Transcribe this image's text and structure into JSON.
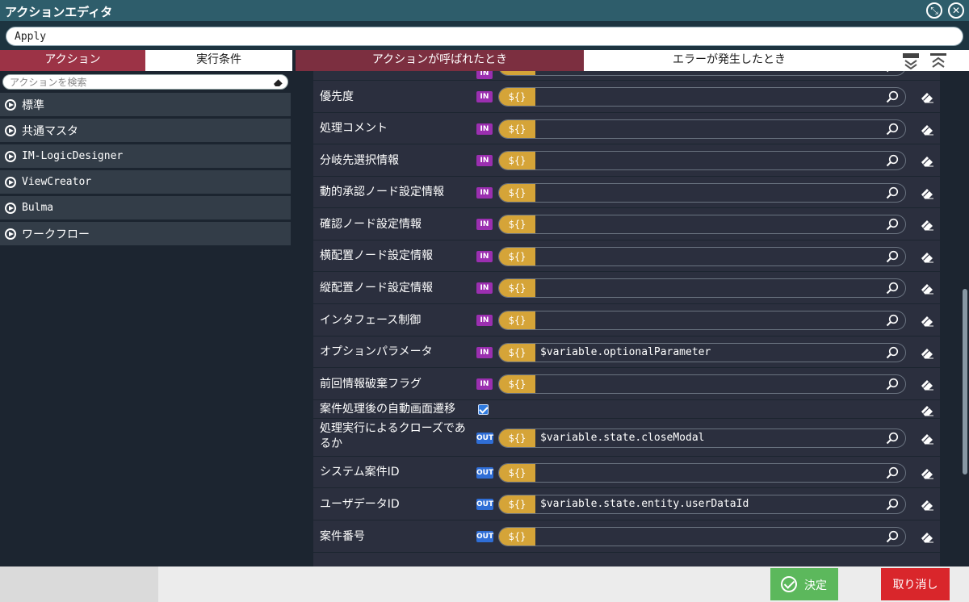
{
  "window": {
    "title": "アクションエディタ"
  },
  "action_name": "Apply",
  "left_tabs": [
    {
      "label": "アクション",
      "active": true
    },
    {
      "label": "実行条件",
      "active": false
    }
  ],
  "action_search": {
    "placeholder": "アクションを検索",
    "value": ""
  },
  "categories": [
    {
      "label": "標準"
    },
    {
      "label": "共通マスタ"
    },
    {
      "label": "IM-LogicDesigner"
    },
    {
      "label": "ViewCreator"
    },
    {
      "label": "Bulma"
    },
    {
      "label": "ワークフロー"
    }
  ],
  "right_tabs": [
    {
      "label": "アクションが呼ばれたとき",
      "active": true
    },
    {
      "label": "エラーが発生したとき",
      "active": false
    }
  ],
  "template_token": "${}",
  "params": [
    {
      "label": "優先度",
      "dir": "IN",
      "value": ""
    },
    {
      "label": "処理コメント",
      "dir": "IN",
      "value": ""
    },
    {
      "label": "分岐先選択情報",
      "dir": "IN",
      "value": ""
    },
    {
      "label": "動的承認ノード設定情報",
      "dir": "IN",
      "value": ""
    },
    {
      "label": "確認ノード設定情報",
      "dir": "IN",
      "value": ""
    },
    {
      "label": "横配置ノード設定情報",
      "dir": "IN",
      "value": ""
    },
    {
      "label": "縦配置ノード設定情報",
      "dir": "IN",
      "value": ""
    },
    {
      "label": "インタフェース制御",
      "dir": "IN",
      "value": ""
    },
    {
      "label": "オプションパラメータ",
      "dir": "IN",
      "value": "$variable.optionalParameter"
    },
    {
      "label": "前回情報破棄フラグ",
      "dir": "IN",
      "value": ""
    },
    {
      "label": "案件処理後の自動画面遷移",
      "type": "checkbox",
      "checked": true
    },
    {
      "label": "処理実行によるクローズであるか",
      "dir": "OUT",
      "value": "$variable.state.closeModal"
    },
    {
      "label": "システム案件ID",
      "dir": "OUT",
      "value": ""
    },
    {
      "label": "ユーザデータID",
      "dir": "OUT",
      "value": "$variable.state.entity.userDataId"
    },
    {
      "label": "案件番号",
      "dir": "OUT",
      "value": ""
    }
  ],
  "footer": {
    "ok_label": "決定",
    "cancel_label": "取り消し"
  },
  "colors": {
    "accent": "#9c3346",
    "template": "#d5a438",
    "in_badge": "#9b2fb0",
    "out_badge": "#2f6ed6",
    "ok": "#5cb85c",
    "cancel": "#d9262b"
  }
}
